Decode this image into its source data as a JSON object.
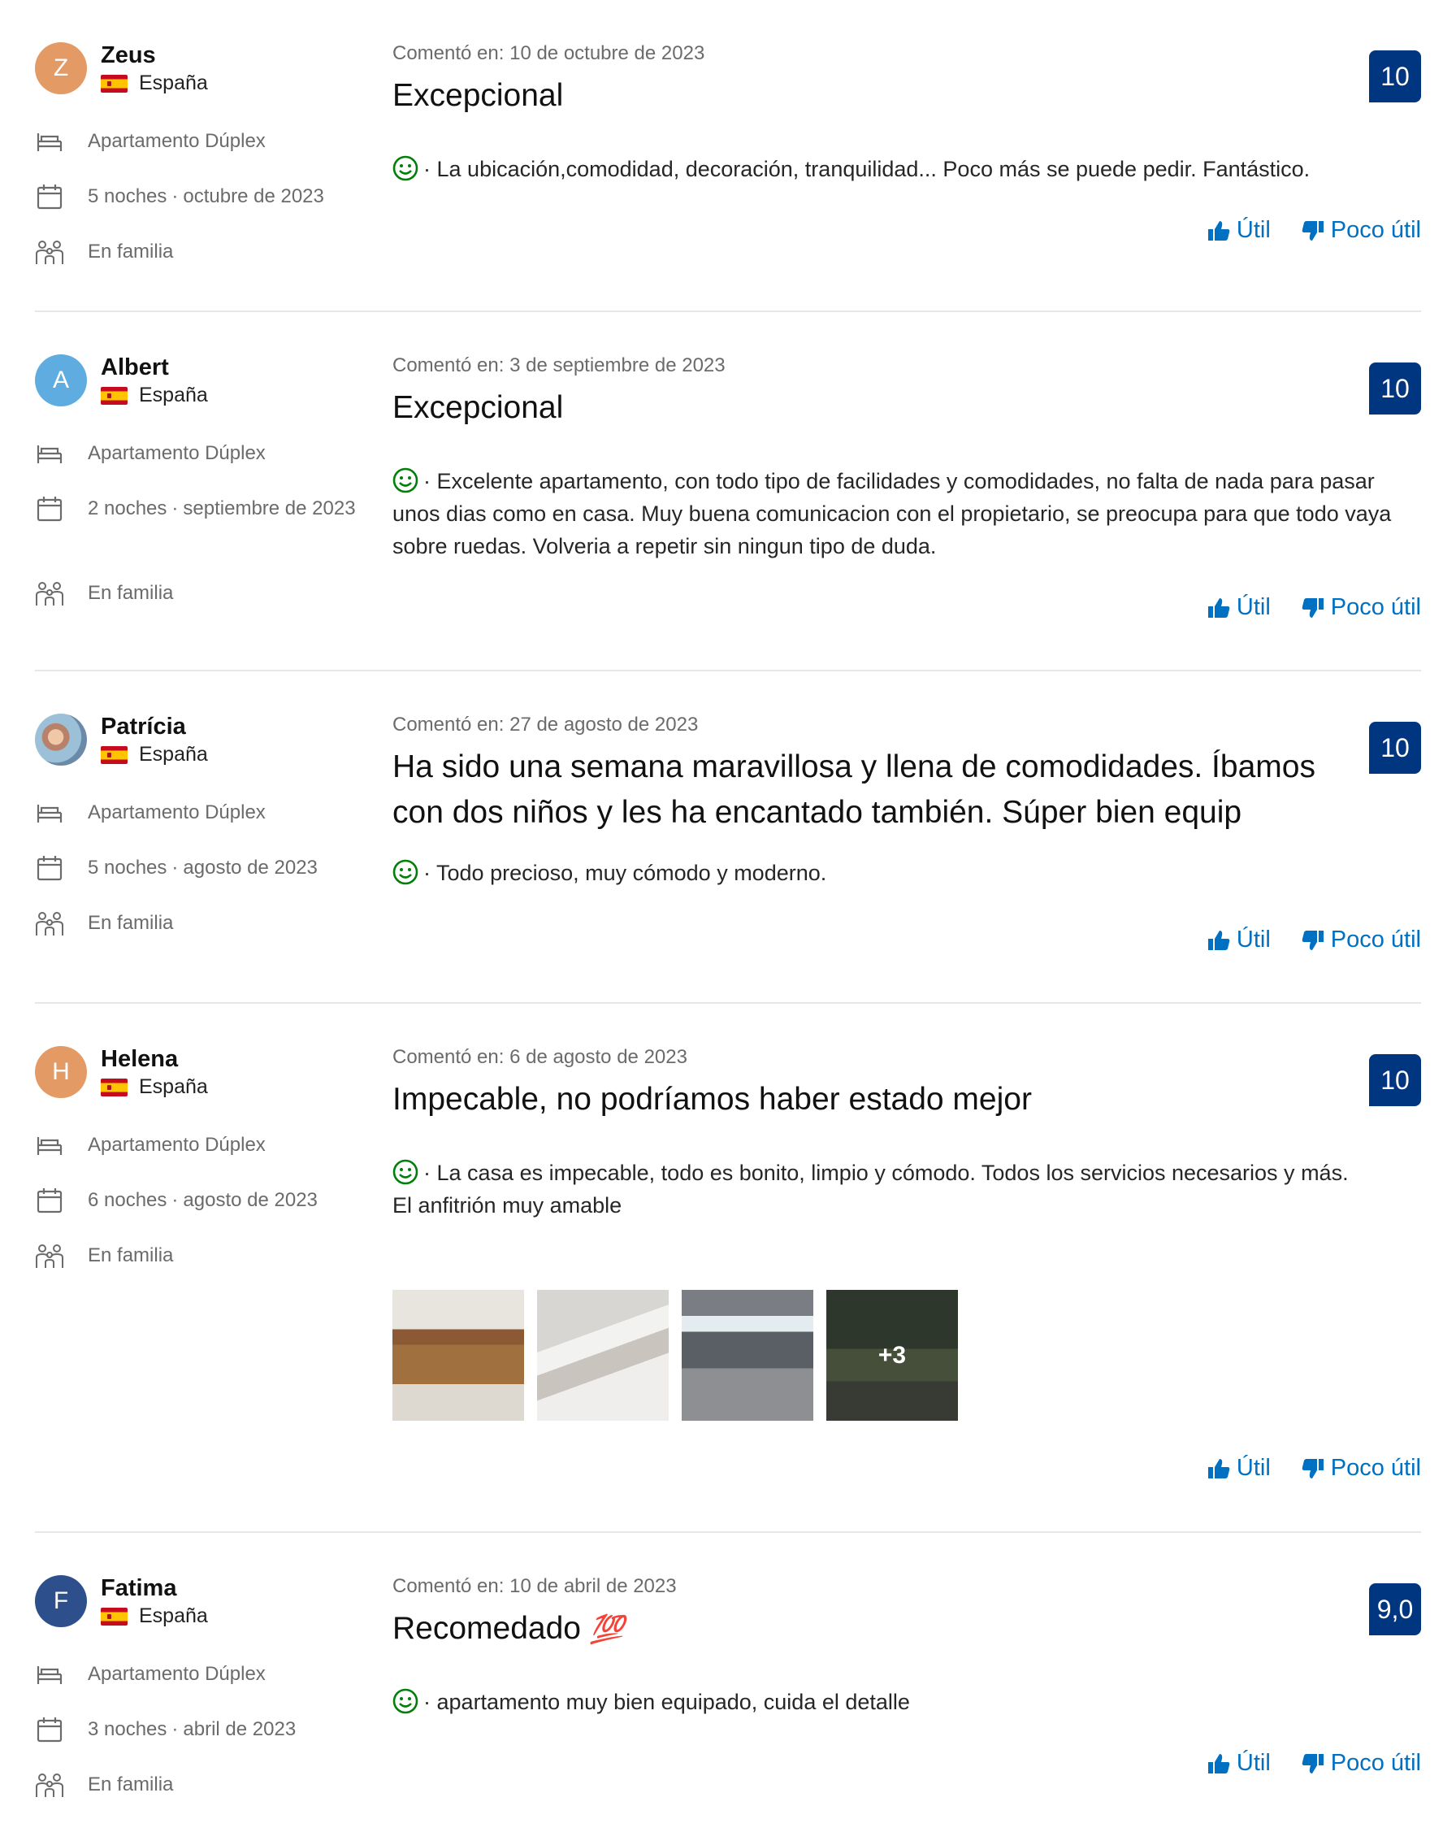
{
  "common": {
    "util_label": "Útil",
    "poco_util_label": "Poco útil",
    "room_label": "Apartamento Dúplex",
    "group_label": "En familia",
    "date_prefix": "Comentó en:",
    "bullet": "·",
    "colors": {
      "score_bg": "#003580",
      "link": "#0071c2",
      "positive": "#008009"
    }
  },
  "reviews": [
    {
      "initial": "Z",
      "avatar_color": "#e39a64",
      "name": "Zeus",
      "country": "España",
      "nights": "5 noches",
      "stay_month": "octubre de 2023",
      "date": "10 de octubre de 2023",
      "score": "10",
      "title": "Excepcional",
      "body": "La ubicación,comodidad, decoración, tranquilidad... Poco más se puede pedir. Fantástico."
    },
    {
      "initial": "A",
      "avatar_color": "#5eace0",
      "name": "Albert",
      "country": "España",
      "nights": "2 noches",
      "stay_month": "septiembre de 2023",
      "date": "3 de septiembre de 2023",
      "score": "10",
      "title": "Excepcional",
      "body": "Excelente apartamento, con todo tipo de facilidades y comodidades, no falta de nada para pasar unos dias como en casa. Muy buena comunicacion con el propietario, se preocupa para que todo vaya sobre ruedas. Volveria a repetir sin ningun tipo de duda."
    },
    {
      "initial": "",
      "avatar_color": "#9cc0d8",
      "name": "Patrícia",
      "country": "España",
      "nights": "5 noches",
      "stay_month": "agosto de 2023",
      "date": "27 de agosto de 2023",
      "score": "10",
      "title": "Ha sido una semana maravillosa y llena de comodidades. Íbamos con dos niños y les ha encantado también. Súper bien equip",
      "body": "Todo precioso, muy cómodo y moderno."
    },
    {
      "initial": "H",
      "avatar_color": "#e39a64",
      "name": "Helena",
      "country": "España",
      "nights": "6 noches",
      "stay_month": "agosto de 2023",
      "date": "6 de agosto de 2023",
      "score": "10",
      "title": "Impecable, no podríamos haber estado mejor",
      "body": "La casa es impecable, todo es bonito, limpio y cómodo. Todos los servicios necesarios y más.",
      "body2": "El anfitrión muy amable",
      "photos_more": "+3"
    },
    {
      "initial": "F",
      "avatar_color": "#2d4f8c",
      "name": "Fatima",
      "country": "España",
      "nights": "3 noches",
      "stay_month": "abril de 2023",
      "date": "10 de abril de 2023",
      "score": "9,0",
      "title": "Recomedado",
      "title_emoji": "💯",
      "body": "apartamento muy bien equipado, cuida el detalle"
    }
  ]
}
